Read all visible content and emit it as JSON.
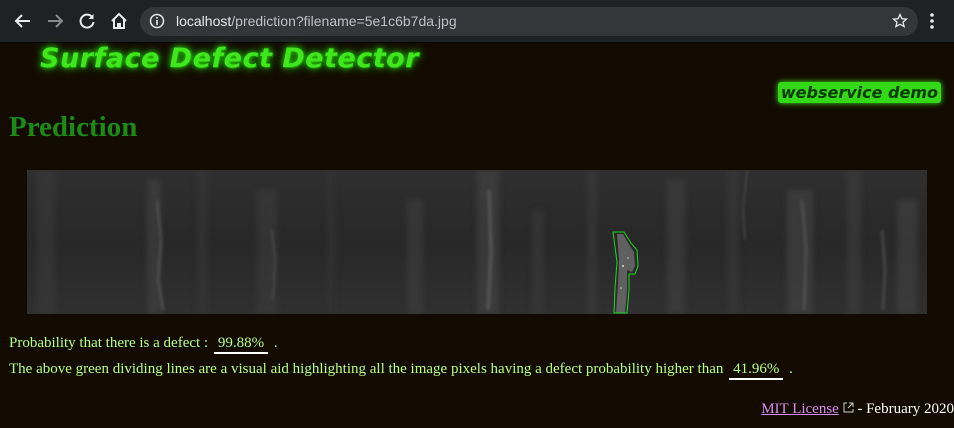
{
  "browser": {
    "url_host": "localhost",
    "url_path": "/prediction?filename=5e1c6b7da.jpg",
    "icons": {
      "back": "back-arrow-icon",
      "forward": "forward-arrow-icon",
      "reload": "reload-icon",
      "home": "home-icon",
      "info": "info-icon",
      "star": "star-icon",
      "menu": "kebab-menu-icon"
    }
  },
  "header": {
    "logo_text": "Surface Defect Detector",
    "badge_text": "webservice demo"
  },
  "main": {
    "title": "Prediction",
    "image_name": "5e1c6b7da.jpg",
    "probability_label": "Probability that there is a defect :",
    "probability_value": "99.88%",
    "probability_suffix": ".",
    "explanation_label": "The above green dividing lines are a visual aid highlighting all the image pixels having a defect probability higher than",
    "threshold_value": "41.96%",
    "explanation_suffix": "."
  },
  "footer": {
    "license_link": "MIT License",
    "date_text": " - February 2020"
  },
  "colors": {
    "page_background": "#140b00",
    "accent_green": "#3fe81c",
    "title_green": "#1c8a14",
    "text_green": "#b4ff7c",
    "link_purple": "#d58cf5"
  }
}
